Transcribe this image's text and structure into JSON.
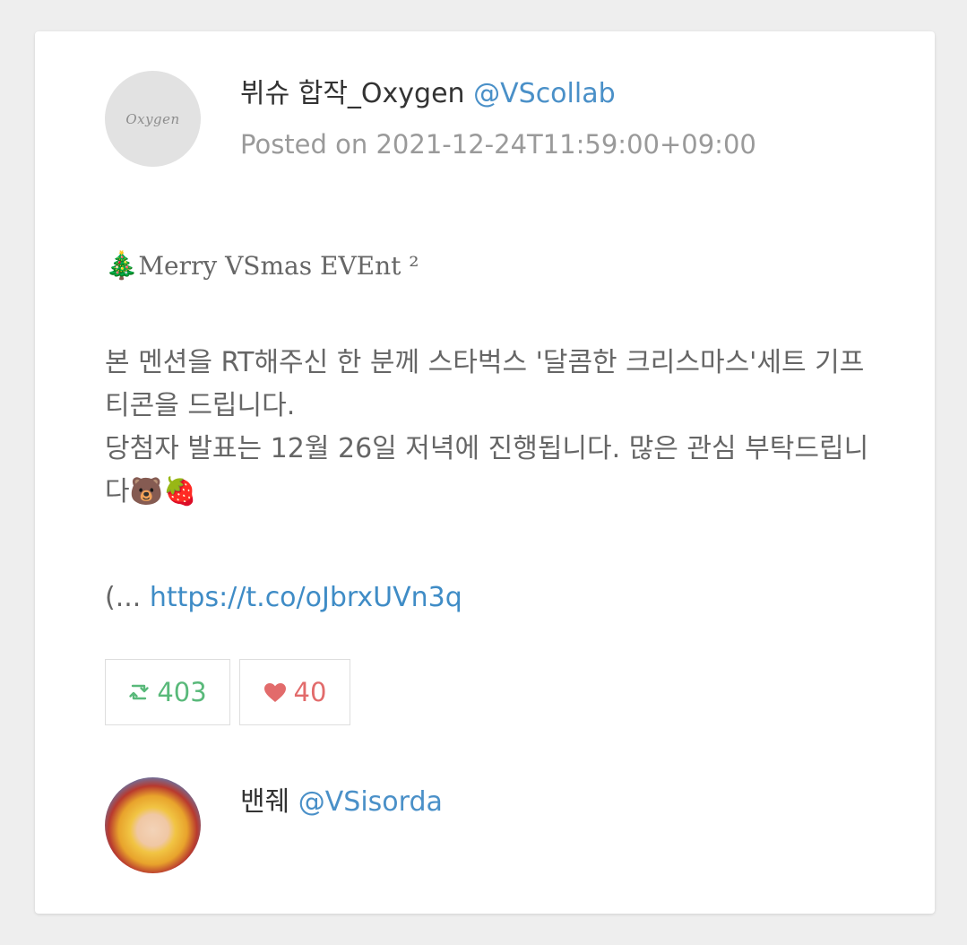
{
  "post": {
    "author_name": "뷔슈 합작_Oxygen",
    "author_handle": "@VScollab",
    "avatar_text": "Oxygen",
    "posted": "Posted on 2021-12-24T11:59:00+09:00",
    "title_emoji": "🎄",
    "title_text": "Merry VSmas EVEnt ²",
    "body_line1": "본 멘션을 RT해주신 한 분께 스타벅스 '달콤한 크리스마스'세트 기프티콘을 드립니다.",
    "body_line2": "당첨자 발표는 12월 26일 저녁에 진행됩니다. 많은 관심 부탁드립니다",
    "body_emojis": "🐻🍓",
    "more_prefix": "(...",
    "link": "https://t.co/oJbrxUVn3q",
    "retweets": "403",
    "likes": "40"
  },
  "reply": {
    "author_name": "밴줴",
    "author_handle": "@VSisorda"
  },
  "colors": {
    "link": "#4a90c8",
    "retweet": "#59b97a",
    "like": "#e26b6b",
    "muted": "#9a9a9a"
  },
  "icons": {
    "retweet": "retweet-icon",
    "like": "heart-icon"
  }
}
